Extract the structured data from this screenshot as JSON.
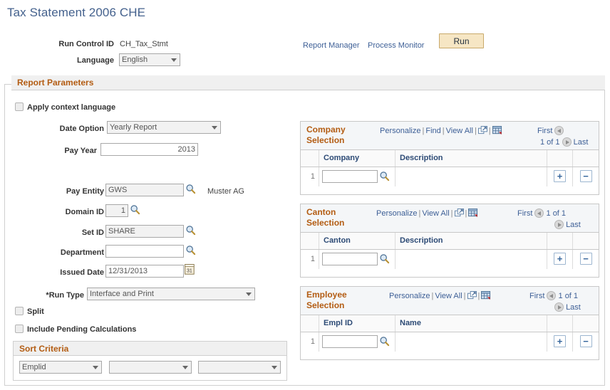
{
  "page": {
    "title": "Tax Statement 2006 CHE"
  },
  "runcontrol": {
    "id_label": "Run Control ID",
    "id_value": "CH_Tax_Stmt",
    "language_label": "Language",
    "language_value": "English"
  },
  "toolbar": {
    "report_manager": "Report Manager",
    "process_monitor": "Process Monitor",
    "run_label": "Run"
  },
  "report_parameters": {
    "section_title": "Report Parameters",
    "apply_context_language_label": "Apply context language",
    "apply_context_language_checked": false,
    "date_option_label": "Date Option",
    "date_option_value": "Yearly Report",
    "pay_year_label": "Pay Year",
    "pay_year_value": "2013",
    "pay_entity_label": "Pay Entity",
    "pay_entity_value": "GWS",
    "pay_entity_description": "Muster AG",
    "domain_id_label": "Domain ID",
    "domain_id_value": "1",
    "set_id_label": "Set ID",
    "set_id_value": "SHARE",
    "department_label": "Department",
    "department_value": "",
    "issued_date_label": "Issued Date",
    "issued_date_value": "12/31/2013",
    "run_type_label": "*Run Type",
    "run_type_value": "Interface and Print",
    "split_label": "Split",
    "split_checked": false,
    "include_pending_label": "Include Pending Calculations",
    "include_pending_checked": false
  },
  "sort_criteria": {
    "title": "Sort Criteria",
    "fields": [
      {
        "value": "Emplid"
      },
      {
        "value": ""
      },
      {
        "value": ""
      }
    ]
  },
  "grids": [
    {
      "title": "Company Selection",
      "links": [
        "Personalize",
        "Find",
        "View All"
      ],
      "nav_first": "First",
      "nav_counter": "1 of 1",
      "nav_last": "Last",
      "columns": [
        "Company",
        "Description"
      ],
      "rows": [
        {
          "index": "1",
          "key": "",
          "description": ""
        }
      ]
    },
    {
      "title": "Canton Selection",
      "links": [
        "Personalize",
        "View All"
      ],
      "nav_first": "First",
      "nav_counter": "1 of 1",
      "nav_last": "Last",
      "columns": [
        "Canton",
        "Description"
      ],
      "rows": [
        {
          "index": "1",
          "key": "",
          "description": ""
        }
      ]
    },
    {
      "title": "Employee Selection",
      "links": [
        "Personalize",
        "View All"
      ],
      "nav_first": "First",
      "nav_counter": "1 of 1",
      "nav_last": "Last",
      "columns": [
        "Empl ID",
        "Name"
      ],
      "rows": [
        {
          "index": "1",
          "key": "",
          "description": ""
        }
      ]
    }
  ],
  "buttons": {
    "add_row": "+",
    "delete_row": "−"
  },
  "colors": {
    "title_blue": "#44618d",
    "section_orange": "#b35c12",
    "link_blue": "#3d5f96",
    "run_button_bg": "#f6e6c4",
    "run_button_border": "#c9a96a",
    "column_header_blue": "#2c4a75"
  }
}
